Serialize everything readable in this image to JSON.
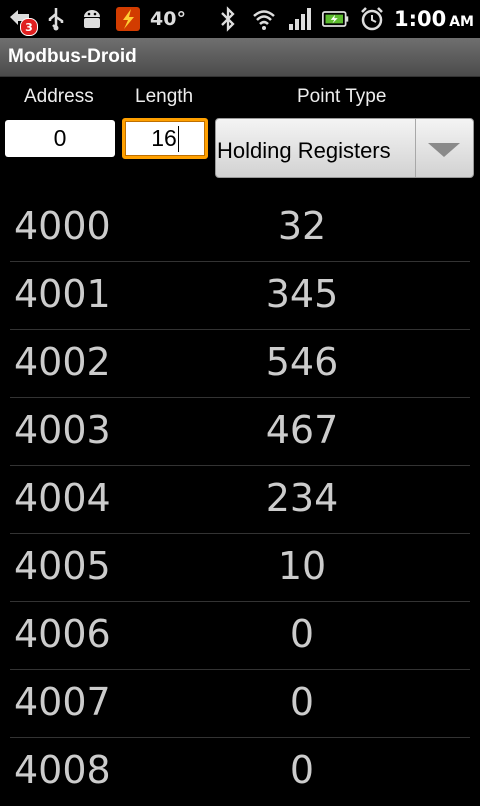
{
  "status_bar": {
    "notification_badge": "3",
    "temperature": "40°",
    "time": "1:00",
    "ampm": "AM",
    "icons": [
      "notification-icon",
      "usb-icon",
      "android-debug-icon",
      "flash-icon",
      "bluetooth-icon",
      "wifi-icon",
      "signal-icon",
      "battery-charging-icon",
      "alarm-icon"
    ]
  },
  "app": {
    "title": "Modbus-Droid"
  },
  "form": {
    "address_label": "Address",
    "length_label": "Length",
    "point_type_label": "Point Type",
    "address_value": "0",
    "length_value": "16",
    "point_type_value": "Holding Registers"
  },
  "registers": [
    {
      "address": "4000",
      "value": "32"
    },
    {
      "address": "4001",
      "value": "345"
    },
    {
      "address": "4002",
      "value": "546"
    },
    {
      "address": "4003",
      "value": "467"
    },
    {
      "address": "4004",
      "value": "234"
    },
    {
      "address": "4005",
      "value": "10"
    },
    {
      "address": "4006",
      "value": "0"
    },
    {
      "address": "4007",
      "value": "0"
    },
    {
      "address": "4008",
      "value": "0"
    }
  ],
  "colors": {
    "focus": "#ffa000",
    "background": "#000000",
    "title_bar": "#5a5a5a"
  }
}
